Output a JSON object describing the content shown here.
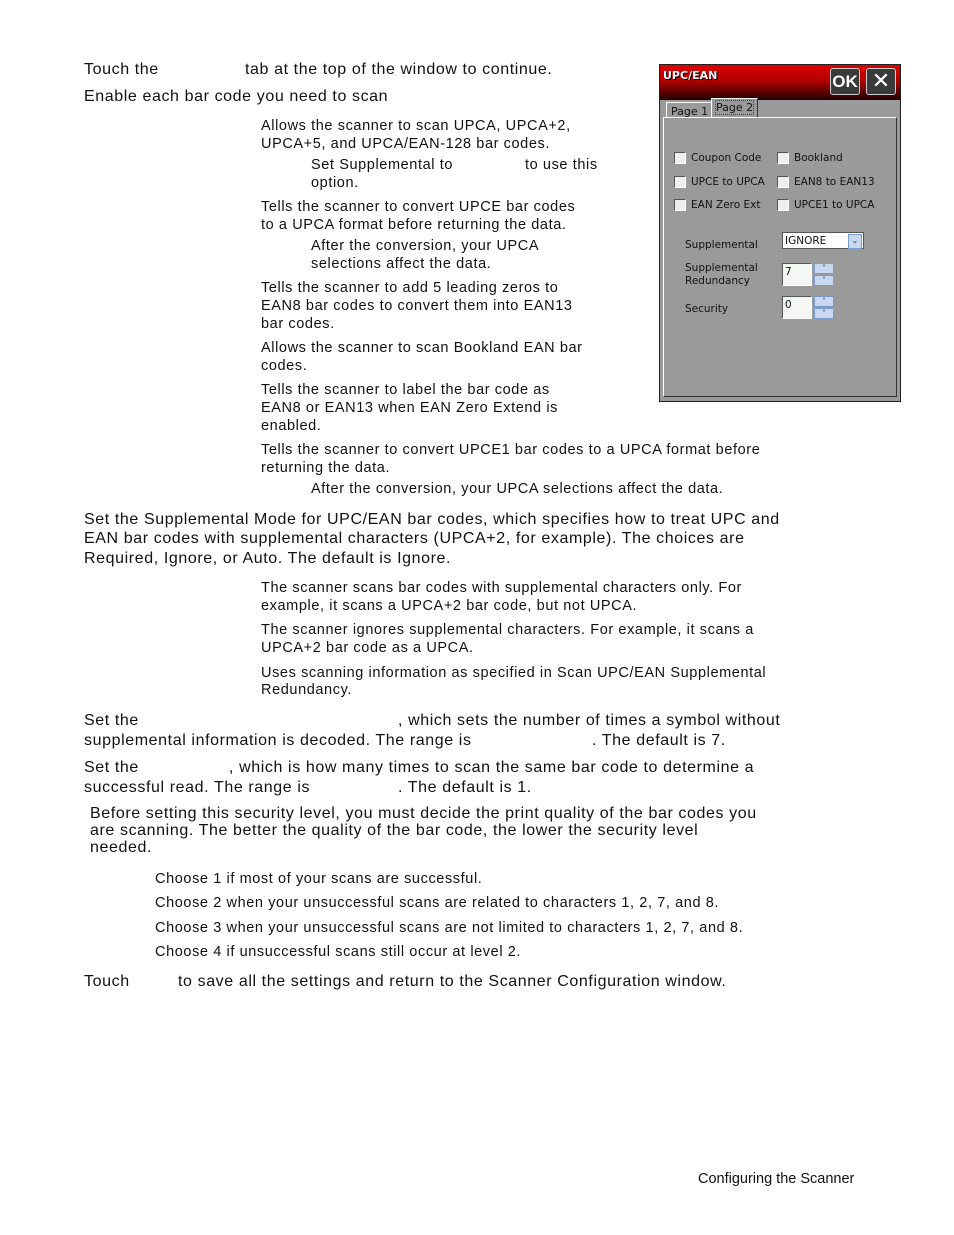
{
  "body": {
    "line1_a": "Touch the",
    "line1_b": "tab at the top of the window to continue.",
    "line2": "Enable each bar code you need to scan",
    "coupon_desc_1": "Allows the scanner to scan UPCA, UPCA+2,",
    "coupon_desc_2": "UPCA+5, and UPCA/EAN-128 bar codes.",
    "coupon_note_a": "Set Supplemental to",
    "coupon_note_b": "to use this",
    "coupon_note_c": "option.",
    "upce_desc_1": "Tells the scanner to convert UPCE bar codes",
    "upce_desc_2": "to a UPCA format before returning the data.",
    "upce_note_1": "After the conversion, your UPCA",
    "upce_note_2": "selections affect the data.",
    "eanzero_desc_1": "Tells the scanner to add 5 leading zeros to",
    "eanzero_desc_2": "EAN8 bar codes to convert them into EAN13",
    "eanzero_desc_3": "bar codes.",
    "bookland_desc_1": "Allows the scanner to scan Bookland EAN bar",
    "bookland_desc_2": "codes.",
    "ean8_desc_1": "Tells the scanner to label the bar code as",
    "ean8_desc_2": "EAN8 or EAN13 when EAN Zero Extend is",
    "ean8_desc_3": "enabled.",
    "upce1_desc_1": "Tells the scanner to convert UPCE1 bar codes to a UPCA format before",
    "upce1_desc_2": "returning the data.",
    "upce1_note": "After the conversion, your UPCA selections affect the data.",
    "supp_1": "Set the Supplemental Mode for UPC/EAN bar codes, which specifies how to treat UPC and",
    "supp_2": "EAN bar codes with supplemental characters (UPCA+2, for example).  The choices are",
    "supp_3": "Required, Ignore, or Auto.  The default is Ignore.",
    "req_1": "The scanner scans bar codes with supplemental characters only.  For",
    "req_2": "example, it scans a UPCA+2 bar code, but not UPCA.",
    "ign_1": "The scanner ignores supplemental characters.  For example, it scans a",
    "ign_2": "UPCA+2 bar code as a UPCA.",
    "auto_1": "Uses scanning information as specified in Scan UPC/EAN Supplemental",
    "auto_2": "Redundancy.",
    "red_1a": "Set the",
    "red_1b": ", which sets the number of times a symbol without",
    "red_2a": "supplemental information is decoded.  The range is",
    "red_2b": ".  The default is 7.",
    "sec_1a": "Set the",
    "sec_1b": ", which is how many times to scan the same bar code to determine a",
    "sec_2a": "successful read.  The range is",
    "sec_2b": ".  The default is 1.",
    "before_1": "Before setting this security level, you must decide the print quality of the bar codes you",
    "before_2": "are scanning.  The better the quality of the bar code, the lower the security level",
    "before_3": "needed.",
    "choose_1": "Choose 1 if most of your scans are successful.",
    "choose_2": "Choose 2 when your unsuccessful scans are related to characters 1, 2, 7, and 8.",
    "choose_3": "Choose 3 when your unsuccessful scans are not limited to characters 1, 2, 7, and 8.",
    "choose_4": "Choose 4 if unsuccessful scans still occur at level 2.",
    "touch_a": "Touch",
    "touch_b": "to save all the settings and return to the Scanner Configuration window."
  },
  "footer": "Configuring the Scanner",
  "dialog": {
    "title": "UPC/EAN",
    "ok_label": "OK",
    "close_label": "✕",
    "tabs": [
      "Page 1",
      "Page 2"
    ],
    "active_tab": "Page 2",
    "checkboxes": {
      "coupon_code": "Coupon Code",
      "bookland": "Bookland",
      "upce_to_upca": "UPCE to UPCA",
      "ean8_to_ean13": "EAN8 to EAN13",
      "ean_zero_ext": "EAN Zero Ext",
      "upce1_to_upca": "UPCE1 to UPCA"
    },
    "supplemental_label": "Supplemental",
    "supplemental_value": "IGNORE",
    "redundancy_label_1": "Supplemental",
    "redundancy_label_2": "Redundancy",
    "redundancy_value": "7",
    "security_label": "Security",
    "security_value": "0",
    "colors": {
      "titlebar": "#c00000",
      "panel": "#9a9a9a",
      "spin_button": "#c8d8f0"
    }
  }
}
